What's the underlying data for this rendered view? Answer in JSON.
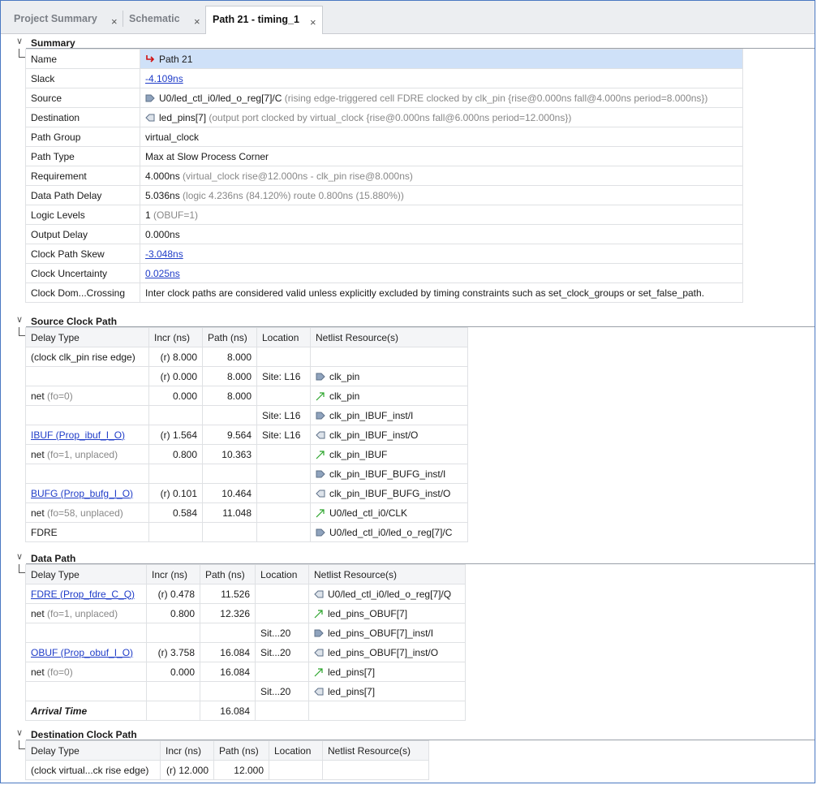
{
  "tabs": [
    {
      "label": "Project Summary",
      "close": "×"
    },
    {
      "label": "Schematic",
      "close": "×"
    },
    {
      "label": "Path 21 - timing_1",
      "close": "×"
    }
  ],
  "summary": {
    "title": "Summary",
    "rows": [
      {
        "label": "Name",
        "value": "Path 21"
      },
      {
        "label": "Slack",
        "value": "-4.109ns"
      },
      {
        "label": "Source",
        "value": "U0/led_ctl_i0/led_o_reg[7]/C",
        "note": "(rising edge-triggered cell FDRE clocked by clk_pin  {rise@0.000ns fall@4.000ns period=8.000ns})"
      },
      {
        "label": "Destination",
        "value": "led_pins[7]",
        "note": "(output port clocked by virtual_clock  {rise@0.000ns fall@6.000ns period=12.000ns})"
      },
      {
        "label": "Path Group",
        "value": "virtual_clock"
      },
      {
        "label": "Path Type",
        "value": "Max at Slow Process Corner"
      },
      {
        "label": "Requirement",
        "value": "4.000ns",
        "note": "(virtual_clock rise@12.000ns - clk_pin rise@8.000ns)"
      },
      {
        "label": "Data Path Delay",
        "value": "5.036ns",
        "note": "(logic 4.236ns (84.120%)  route 0.800ns (15.880%))"
      },
      {
        "label": "Logic Levels",
        "value": "1",
        "note": "(OBUF=1)"
      },
      {
        "label": "Output Delay",
        "value": "0.000ns"
      },
      {
        "label": "Clock Path Skew",
        "value": "-3.048ns"
      },
      {
        "label": "Clock Uncertainty",
        "value": "0.025ns"
      },
      {
        "label": "Clock Dom...Crossing",
        "value": "Inter clock paths are considered valid unless explicitly excluded by timing constraints such as set_clock_groups or set_false_path."
      }
    ]
  },
  "columns": [
    "Delay Type",
    "Incr (ns)",
    "Path (ns)",
    "Location",
    "Netlist Resource(s)"
  ],
  "source_clock_path": {
    "title": "Source Clock Path",
    "rows": [
      {
        "type": "(clock clk_pin rise edge)",
        "note": "",
        "incr": "(r) 8.000",
        "path": "8.000",
        "loc": "",
        "res": "",
        "icon": ""
      },
      {
        "type": "",
        "note": "",
        "incr": "(r) 0.000",
        "path": "8.000",
        "loc": "Site: L16",
        "res": "clk_pin",
        "icon": "pin-in"
      },
      {
        "type": "net",
        "note": "(fo=0)",
        "incr": "0.000",
        "path": "8.000",
        "loc": "",
        "res": "clk_pin",
        "icon": "net"
      },
      {
        "type": "",
        "note": "",
        "incr": "",
        "path": "",
        "loc": "Site: L16",
        "res": "clk_pin_IBUF_inst/I",
        "icon": "pin-in"
      },
      {
        "type": "IBUF (Prop_ibuf_I_O)",
        "note": "",
        "incr": "(r) 1.564",
        "path": "9.564",
        "loc": "Site: L16",
        "res": "clk_pin_IBUF_inst/O",
        "icon": "pin-out",
        "link": true
      },
      {
        "type": "net",
        "note": "(fo=1, unplaced)",
        "incr": "0.800",
        "path": "10.363",
        "loc": "",
        "res": "clk_pin_IBUF",
        "icon": "net"
      },
      {
        "type": "",
        "note": "",
        "incr": "",
        "path": "",
        "loc": "",
        "res": "clk_pin_IBUF_BUFG_inst/I",
        "icon": "pin-in"
      },
      {
        "type": "BUFG (Prop_bufg_I_O)",
        "note": "",
        "incr": "(r) 0.101",
        "path": "10.464",
        "loc": "",
        "res": "clk_pin_IBUF_BUFG_inst/O",
        "icon": "pin-out",
        "link": true
      },
      {
        "type": "net",
        "note": "(fo=58, unplaced)",
        "incr": "0.584",
        "path": "11.048",
        "loc": "",
        "res": "U0/led_ctl_i0/CLK",
        "icon": "net"
      },
      {
        "type": "FDRE",
        "note": "",
        "incr": "",
        "path": "",
        "loc": "",
        "res": "U0/led_ctl_i0/led_o_reg[7]/C",
        "icon": "pin-in"
      }
    ]
  },
  "data_path": {
    "title": "Data Path",
    "rows": [
      {
        "type": "FDRE (Prop_fdre_C_Q)",
        "note": "",
        "incr": "(r) 0.478",
        "path": "11.526",
        "loc": "",
        "res": "U0/led_ctl_i0/led_o_reg[7]/Q",
        "icon": "pin-out",
        "link": true
      },
      {
        "type": "net",
        "note": "(fo=1, unplaced)",
        "incr": "0.800",
        "path": "12.326",
        "loc": "",
        "res": "led_pins_OBUF[7]",
        "icon": "net"
      },
      {
        "type": "",
        "note": "",
        "incr": "",
        "path": "",
        "loc": "Sit...20",
        "res": "led_pins_OBUF[7]_inst/I",
        "icon": "pin-in"
      },
      {
        "type": "OBUF (Prop_obuf_I_O)",
        "note": "",
        "incr": "(r) 3.758",
        "path": "16.084",
        "loc": "Sit...20",
        "res": "led_pins_OBUF[7]_inst/O",
        "icon": "pin-out",
        "link": true
      },
      {
        "type": "net",
        "note": "(fo=0)",
        "incr": "0.000",
        "path": "16.084",
        "loc": "",
        "res": "led_pins[7]",
        "icon": "net"
      },
      {
        "type": "",
        "note": "",
        "incr": "",
        "path": "",
        "loc": "Sit...20",
        "res": "led_pins[7]",
        "icon": "pin-out"
      },
      {
        "type": "Arrival Time",
        "note": "",
        "incr": "",
        "path": "16.084",
        "loc": "",
        "res": "",
        "icon": "",
        "bold": true
      }
    ]
  },
  "dest_clock_path": {
    "title": "Destination Clock Path",
    "rows": [
      {
        "type": "(clock virtual...ck rise edge)",
        "note": "",
        "incr": "(r) 12.000",
        "path": "12.000",
        "loc": "",
        "res": "",
        "icon": ""
      }
    ]
  },
  "icons": {
    "collapse": "chevron-down-icon",
    "pin_in": "input-pin-icon",
    "pin_out": "output-pin-icon",
    "net": "net-arrow-icon",
    "path": "path-icon"
  }
}
